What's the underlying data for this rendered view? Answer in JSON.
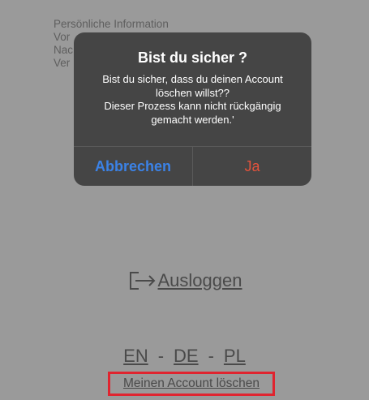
{
  "background": {
    "personal_info": {
      "heading": "Persönliche Information",
      "line_1": "Vor",
      "line_2": "Nac",
      "line_3": "Ver"
    },
    "logout_label": "Ausloggen",
    "languages": [
      "EN",
      "DE",
      "PL"
    ],
    "language_separator": "-",
    "delete_account_label": "Meinen Account löschen"
  },
  "alert": {
    "title": "Bist du sicher ?",
    "message_lines": [
      "Bist du sicher, dass du deinen Account",
      "löschen willst??",
      "Dieser Prozess kann nicht rückgängig",
      "gemacht werden.'"
    ],
    "cancel_label": "Abbrechen",
    "confirm_label": "Ja"
  },
  "colors": {
    "cancel": "#3b82e6",
    "confirm": "#e5533c",
    "highlight_box": "#e0242f"
  },
  "icons": {
    "logout": "logout-arrow-icon"
  }
}
